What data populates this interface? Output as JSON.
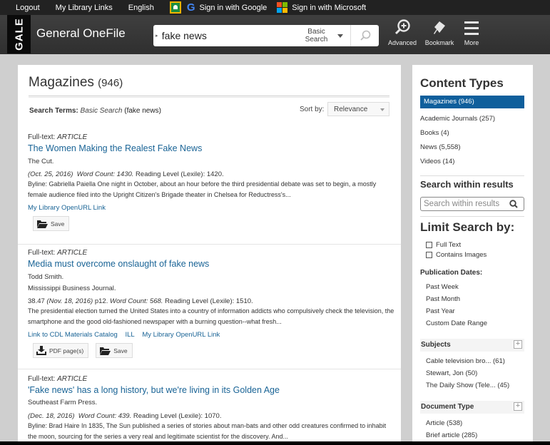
{
  "utility_bar": {
    "logout": "Logout",
    "library_links": "My Library Links",
    "language": "English",
    "google_signin": "Sign in with Google",
    "microsoft_signin": "Sign in with Microsoft"
  },
  "header": {
    "logo": "GALE",
    "product": "General OneFile",
    "search_value": "fake news",
    "search_type_line1": "Basic",
    "search_type_line2": "Search",
    "actions": [
      {
        "label": "Advanced",
        "icon": "advanced-search-icon"
      },
      {
        "label": "Bookmark",
        "icon": "bookmark-icon"
      },
      {
        "label": "More",
        "icon": "menu-icon"
      }
    ]
  },
  "main": {
    "title": "Magazines",
    "count": "(946)",
    "search_terms_label": "Search Terms:",
    "search_terms_type": "Basic Search",
    "search_terms_query": "(fake news)",
    "sort_label": "Sort by:",
    "sort_value": "Relevance",
    "results": [
      {
        "fulltext_label": "Full-text:",
        "type": "ARTICLE",
        "title": "The Women Making the Realest Fake News",
        "source": "The Cut.",
        "date": "(Oct. 25, 2016)",
        "word_count": "Word Count: 1430.",
        "lexile": "Reading Level (Lexile): 1420.",
        "abstract": "Byline: Gabriella Paiella One night in October, about an hour before the third presidential debate was set to begin, a mostly female audience filed into the Upright Citizen's Brigade theater in Chelsea for Reductress's...",
        "links": [
          "My Library OpenURL Link"
        ],
        "buttons": [
          "Save"
        ]
      },
      {
        "fulltext_label": "Full-text:",
        "type": "ARTICLE",
        "title": "Media must overcome onslaught of fake news",
        "author": "Todd Smith.",
        "source": "Mississippi Business Journal.",
        "volume": "38.47",
        "date": "(Nov. 18, 2016)",
        "page": "p12.",
        "word_count": "Word Count: 568.",
        "lexile": "Reading Level (Lexile): 1510.",
        "abstract": "The presidential election turned the United States into a country of information addicts who compulsively check the television, the smartphone and the good old-fashioned newspaper with a burning question--what fresh...",
        "links": [
          "Link to CDL Materials Catalog",
          "ILL",
          "My Library OpenURL Link"
        ],
        "buttons": [
          "PDF page(s)",
          "Save"
        ]
      },
      {
        "fulltext_label": "Full-text:",
        "type": "ARTICLE",
        "title": "'Fake news' has a long history, but we're living in its Golden Age",
        "source": "Southeast Farm Press.",
        "date": "(Dec. 18, 2016)",
        "word_count": "Word Count: 439.",
        "lexile": "Reading Level (Lexile): 1070.",
        "abstract": "Byline: Brad Haire In 1835, The Sun published a series of stories about man-bats and other odd creatures confirmed to inhabit the moon, sourcing for the series a very real and legitimate scientist for the discovery. And..."
      }
    ]
  },
  "sidebar": {
    "content_types_title": "Content Types",
    "content_types": [
      {
        "label": "Magazines (946)",
        "active": true
      },
      {
        "label": "Academic Journals  (257)"
      },
      {
        "label": "Books  (4)"
      },
      {
        "label": "News  (5,558)"
      },
      {
        "label": "Videos  (14)"
      }
    ],
    "search_within_title": "Search within results",
    "search_within_placeholder": "Search within results",
    "limit_title": "Limit Search by:",
    "limit_options": [
      "Full Text",
      "Contains Images"
    ],
    "pub_dates_title": "Publication Dates:",
    "pub_dates": [
      "Past Week",
      "Past Month",
      "Past Year",
      "Custom Date Range"
    ],
    "subjects_title": "Subjects",
    "subjects": [
      "Cable television bro... (61)",
      "Stewart, Jon (50)",
      "The Daily Show (Tele... (45)"
    ],
    "doctype_title": "Document Type",
    "doctypes": [
      "Article (538)",
      "Brief article (285)"
    ],
    "expand_symbol": "+"
  }
}
